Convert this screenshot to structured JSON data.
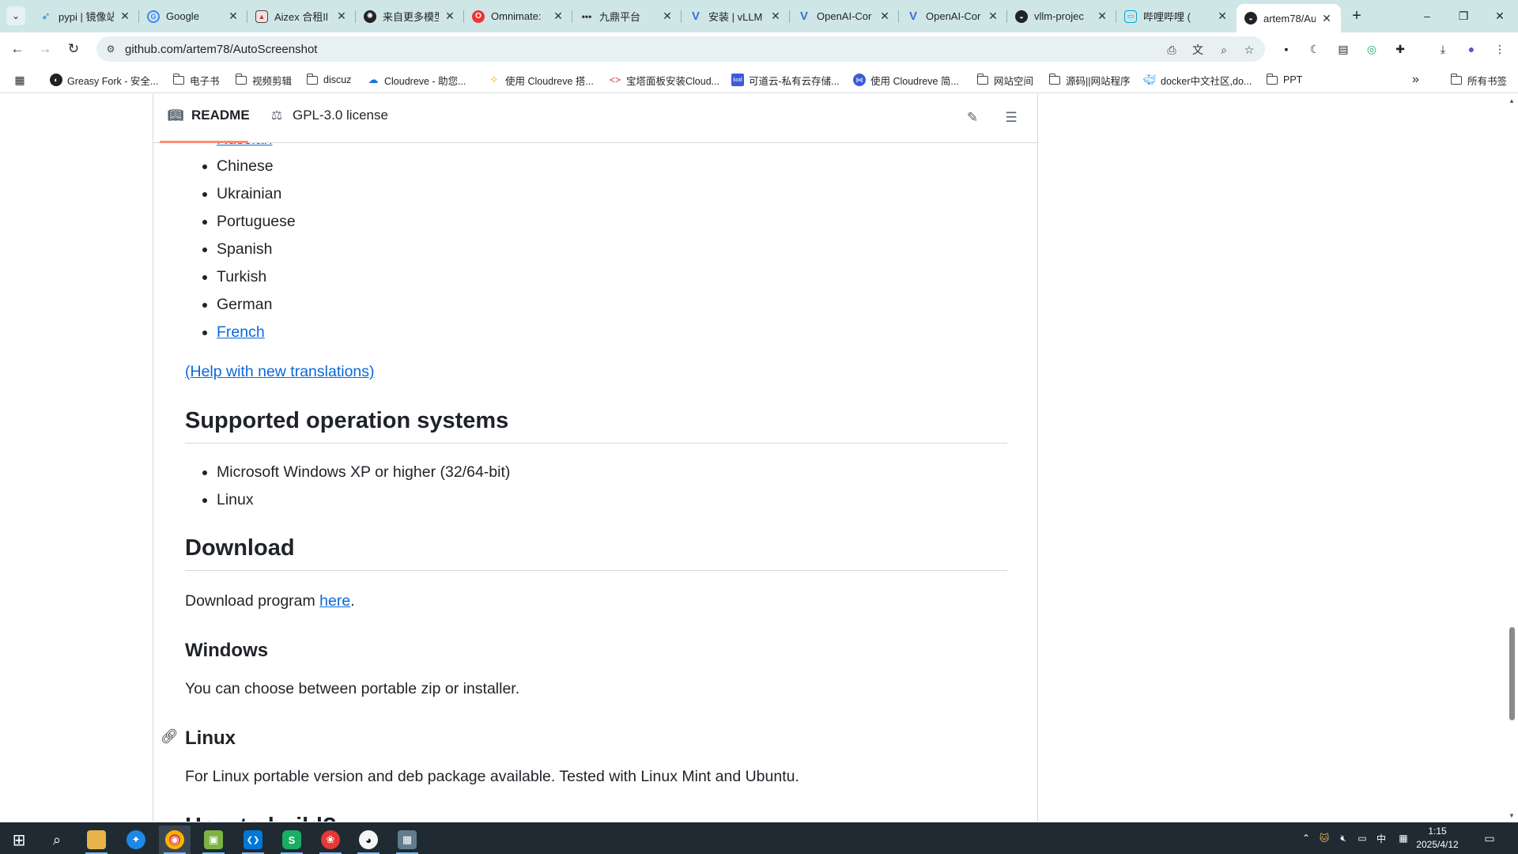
{
  "browser": {
    "tabs": [
      {
        "title": "pypi | 镜像站",
        "favicon": "feather-icon",
        "color": "#2b88d8"
      },
      {
        "title": "Google",
        "favicon": "google-icon",
        "color": "#4285f4"
      },
      {
        "title": "Aizex 合租Il",
        "favicon": "image-icon",
        "color": "#b44"
      },
      {
        "title": "来自更多模型",
        "favicon": "openai-icon",
        "color": "#222"
      },
      {
        "title": "Omnimate:",
        "favicon": "omnimate-icon",
        "color": "#e33"
      },
      {
        "title": "九鼎平台",
        "favicon": "dots-icon",
        "color": "#333"
      },
      {
        "title": "安装 | vLLM",
        "favicon": "vllm-icon",
        "color": "#3a6fd8"
      },
      {
        "title": "OpenAI-Cor",
        "favicon": "vllm-icon",
        "color": "#3a6fd8"
      },
      {
        "title": "OpenAI-Cor",
        "favicon": "vllm-icon",
        "color": "#3a6fd8"
      },
      {
        "title": "vllm-projec",
        "favicon": "github-icon",
        "color": "#1f2328"
      },
      {
        "title": "哔哩哔哩 (",
        "favicon": "bilibili-icon",
        "color": "#00a1d6"
      },
      {
        "title": "artem78/Au",
        "favicon": "github-icon",
        "color": "#1f2328",
        "active": true
      }
    ],
    "new_tab_symbol": "+",
    "window_controls": {
      "minimize": "–",
      "restore": "❐",
      "close": "✕"
    },
    "url": "github.com/artem78/AutoScreenshot",
    "nav": {
      "back": "←",
      "forward": "→",
      "reload": "↻"
    }
  },
  "bookmarks": [
    {
      "label": "Greasy Fork - 安全...",
      "icon": "greasyfork-icon"
    },
    {
      "label": "电子书",
      "icon": "folder-icon"
    },
    {
      "label": "视频剪辑",
      "icon": "folder-icon"
    },
    {
      "label": "discuz",
      "icon": "folder-icon"
    },
    {
      "label": "Cloudreve - 助您...",
      "icon": "cloudreve-icon"
    },
    {
      "label": "使用 Cloudreve 搭...",
      "icon": "bulb-icon"
    },
    {
      "label": "宝塔面板安装Cloud...",
      "icon": "cloud-icon"
    },
    {
      "label": "可道云-私有云存储...",
      "icon": "kodcloud-icon"
    },
    {
      "label": "使用 Cloudreve 简...",
      "icon": "cloudreve-icon"
    },
    {
      "label": "网站空间",
      "icon": "folder-icon"
    },
    {
      "label": "源码||网站程序",
      "icon": "folder-icon"
    },
    {
      "label": "docker中文社区,do...",
      "icon": "docker-icon"
    },
    {
      "label": "PPT",
      "icon": "folder-icon"
    }
  ],
  "bookmarks_overflow": "»",
  "all_bookmarks": "所有书签",
  "readme": {
    "tabs": [
      {
        "label": "README",
        "icon": "book-icon",
        "active": true
      },
      {
        "label": "GPL-3.0 license",
        "icon": "law-icon"
      }
    ],
    "languages_partial": "Russian",
    "languages": [
      "Chinese",
      "Ukrainian",
      "Portuguese",
      "Spanish",
      "Turkish",
      "German"
    ],
    "languages_link": "French",
    "help_link": "(Help with new translations)",
    "os_heading": "Supported operation systems",
    "os_list": [
      "Microsoft Windows XP or higher (32/64-bit)",
      "Linux"
    ],
    "download_heading": "Download",
    "download_text": "Download program ",
    "download_link": "here",
    "download_period": ".",
    "windows_heading": "Windows",
    "windows_text": "You can choose between portable zip or installer.",
    "linux_heading": "Linux",
    "linux_text": "For Linux portable version and deb package available. Tested with Linux Mint and Ubuntu.",
    "next_heading_partial": "How to build?"
  },
  "taskbar": {
    "apps": [
      {
        "name": "start-button",
        "glyph": "⊞",
        "color": "transparent"
      },
      {
        "name": "search-button",
        "glyph": "⌕",
        "color": "transparent"
      },
      {
        "name": "file-explorer",
        "glyph": "▬",
        "color": "#e8b34b"
      },
      {
        "name": "app-blue",
        "glyph": "✦",
        "color": "#1e88e5"
      },
      {
        "name": "chrome",
        "glyph": "◉",
        "color": "#db4437"
      },
      {
        "name": "app-green",
        "glyph": "▣",
        "color": "#7cb342"
      },
      {
        "name": "vscode",
        "glyph": "❮❯",
        "color": "#0078d4"
      },
      {
        "name": "app-green2",
        "glyph": "S",
        "color": "#1aad64"
      },
      {
        "name": "app-red",
        "glyph": "❀",
        "color": "#e53935"
      },
      {
        "name": "qq",
        "glyph": "◕",
        "color": "#111"
      },
      {
        "name": "screenshot-app",
        "glyph": "▦",
        "color": "#607d8b"
      }
    ],
    "tray": {
      "chevron": "⌃",
      "ime": "中",
      "grid": "▦"
    },
    "time": "1:15",
    "date": "2025/4/12"
  }
}
